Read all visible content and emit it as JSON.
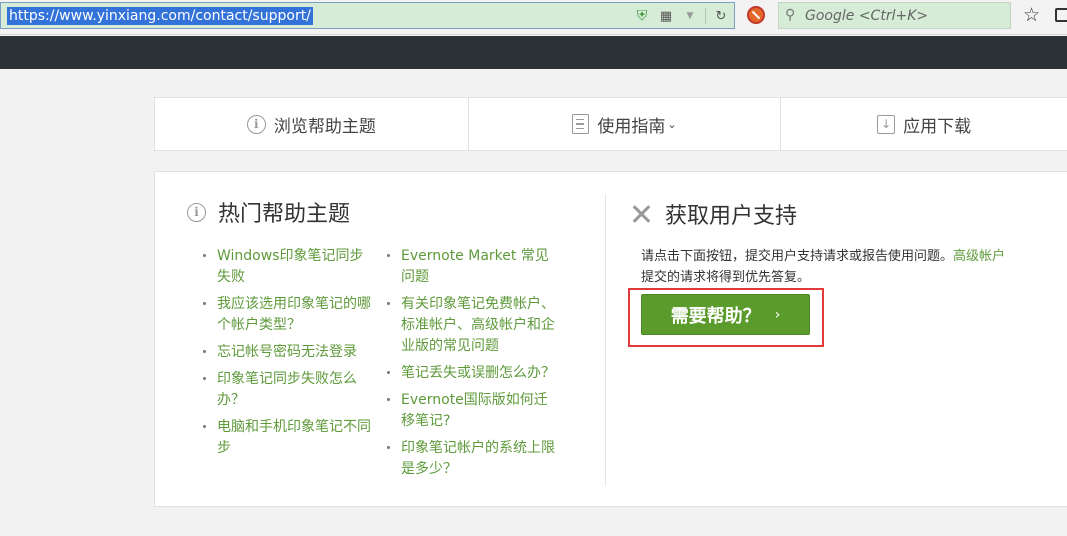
{
  "browser": {
    "url": "https://www.yinxiang.com/contact/support/",
    "search_placeholder": "Google <Ctrl+K>",
    "colors": {
      "url_bg": "#d6ecd6",
      "selection": "#3373d9"
    }
  },
  "nav_tabs": [
    {
      "label": "浏览帮助主题",
      "icon": "info-circle-icon"
    },
    {
      "label": "使用指南",
      "icon": "document-icon",
      "has_dropdown": true
    },
    {
      "label": "应用下载",
      "icon": "download-icon"
    }
  ],
  "popular_topics": {
    "title": "热门帮助主题",
    "column_a": [
      "Windows印象笔记同步失败",
      "我应该选用印象笔记的哪个帐户类型？",
      "忘记帐号密码无法登录",
      "印象笔记同步失败怎么办？",
      "电脑和手机印象笔记不同步"
    ],
    "column_b": [
      "Evernote Market 常见问题",
      "有关印象笔记免费帐户、标准帐户、高级帐户和企业版的常见问题",
      "笔记丢失或误删怎么办？",
      "Evernote国际版如何迁移笔记?",
      "印象笔记帐户的系统上限是多少？"
    ]
  },
  "support": {
    "title": "获取用户支持",
    "desc_text": "请点击下面按钮，提交用户支持请求或报告使用问题。",
    "desc_link": "高级帐户",
    "desc_tail": "提交的请求将得到优先答复。",
    "button_label": "需要帮助？",
    "button_arrow": "›"
  },
  "colors": {
    "accent_green": "#5a9b2b",
    "link_green": "#5e9a3a",
    "header_dark": "#2d3238",
    "highlight_red": "#e03a3a"
  }
}
